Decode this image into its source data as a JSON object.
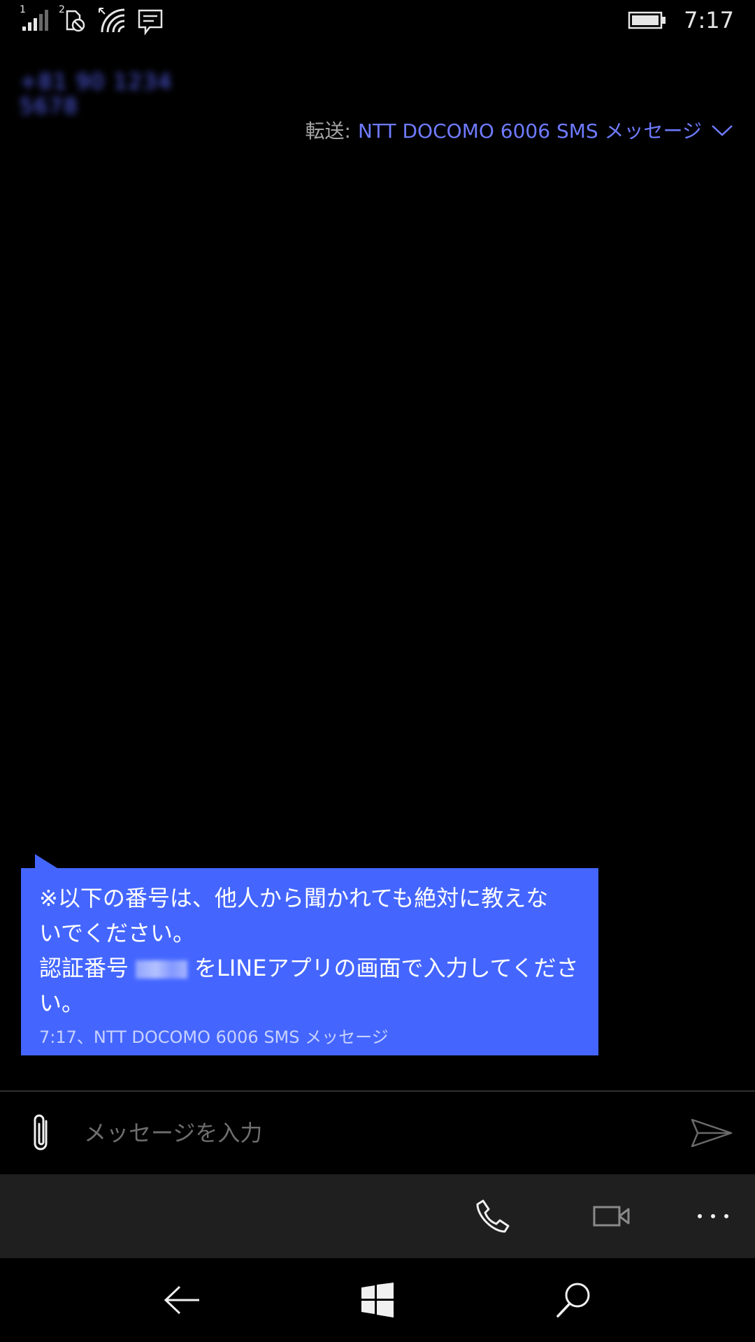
{
  "status_bar": {
    "time": "7:17",
    "sim1_label": "1",
    "sim2_label": "2",
    "icons": [
      "signal-bars-icon",
      "sim2-no-service-icon",
      "wifi-icon",
      "notification-message-icon",
      "battery-icon"
    ]
  },
  "conversation": {
    "contact_name": "+81 90 1234 5678",
    "via_label": "転送:",
    "via_value": "NTT DOCOMO 6006 SMS メッセージ"
  },
  "message": {
    "line1": "※以下の番号は、他人から聞かれても絶対に教えな",
    "line2": "いでください。",
    "line3_prefix": "認証番号",
    "line3_suffix": "をLINEアプリの画面で入力してくださ",
    "line4": "い。",
    "meta": "7:17、NTT DOCOMO 6006 SMS メッセージ",
    "bubble_color": "#4466ff"
  },
  "composer": {
    "placeholder": "メッセージを入力"
  },
  "appbar": {
    "icons": [
      "phone-icon",
      "video-call-icon",
      "more-icon"
    ]
  },
  "navbar": {
    "icons": [
      "back-icon",
      "windows-start-icon",
      "search-icon"
    ]
  },
  "colors": {
    "accent": "#6f7bff",
    "background": "#000000",
    "appbar_bg": "#1f1f1f"
  }
}
